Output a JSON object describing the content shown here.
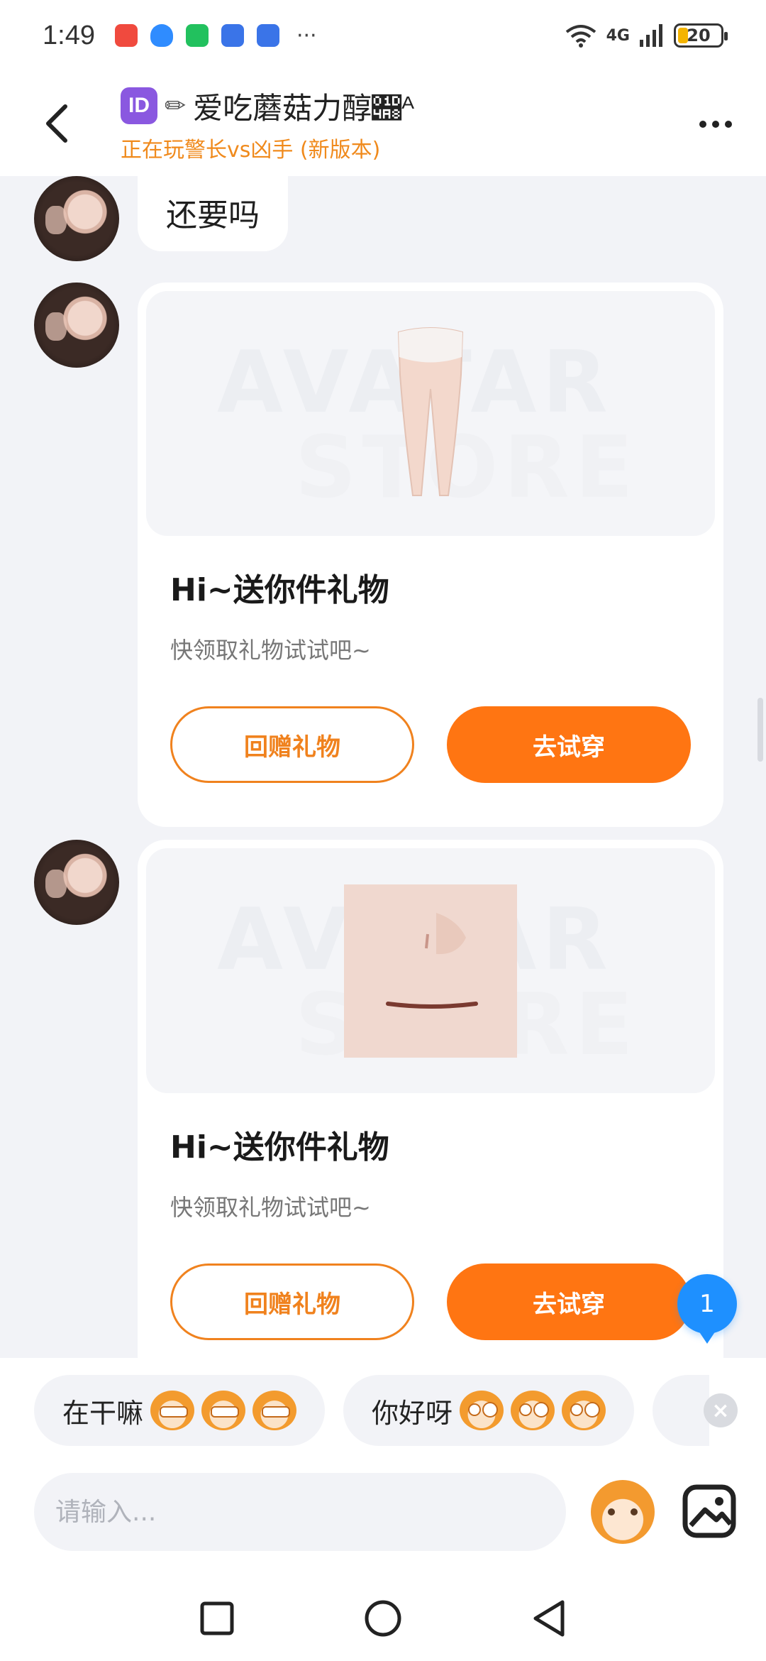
{
  "status_bar": {
    "time": "1:49",
    "network": "4G",
    "battery": "20"
  },
  "header": {
    "badge": "ID",
    "name": "爱吃蘑菇力醇𝒨ᴬ",
    "subtitle": "正在玩警长vs凶手 (新版本)"
  },
  "messages": [
    {
      "type": "text",
      "text": "还要吗"
    },
    {
      "type": "gift",
      "watermark_line1": "AVATAR",
      "watermark_line2": "STORE",
      "title": "Hi~送你件礼物",
      "desc": "快领取礼物试试吧~",
      "btn_return": "回赠礼物",
      "btn_try": "去试穿",
      "item": "leggings"
    },
    {
      "type": "gift",
      "watermark_line1": "AVATAR",
      "watermark_line2": "STORE",
      "title": "Hi~送你件礼物",
      "desc": "快领取礼物试试吧~",
      "btn_return": "回赠礼物",
      "btn_try": "去试穿",
      "item": "face"
    }
  ],
  "unread_count": "1",
  "quick_replies": [
    {
      "text": "在干嘛",
      "emoji": "grin-monkey"
    },
    {
      "text": "你好呀",
      "emoji": "wide-eye-monkey"
    }
  ],
  "input": {
    "placeholder": "请输入..."
  },
  "colors": {
    "accent": "#ff7512",
    "subtitle": "#f08a1c",
    "badge": "#1e90ff"
  }
}
